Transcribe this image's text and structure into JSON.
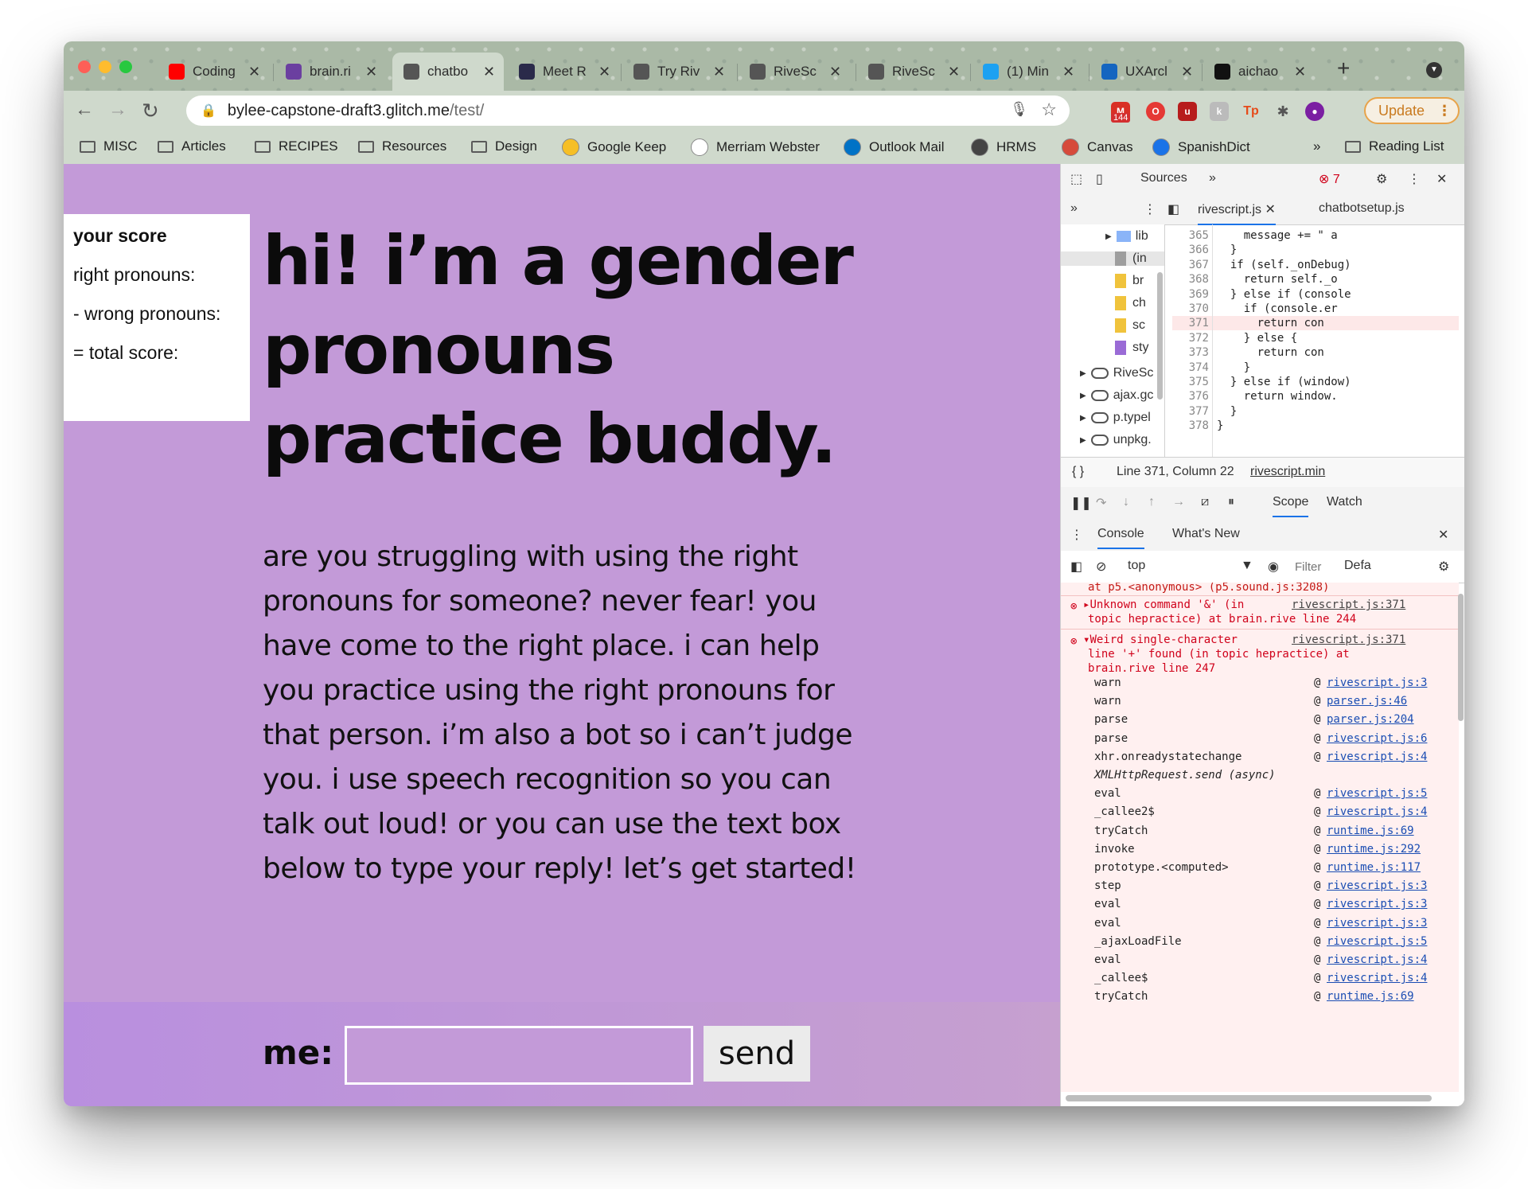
{
  "tabs": [
    {
      "title": "Coding",
      "icon": "youtube-icon",
      "color": "#ff0000",
      "active": false
    },
    {
      "title": "brain.ri",
      "icon": "brain-favicon",
      "color": "#6b3fa0",
      "active": false
    },
    {
      "title": "chatbo",
      "icon": "globe-icon",
      "color": "#555555",
      "active": true
    },
    {
      "title": "Meet R",
      "icon": "robot-icon",
      "color": "#2a2a4a",
      "active": false
    },
    {
      "title": "Try Riv",
      "icon": "rivescript-icon",
      "color": "#555555",
      "active": false
    },
    {
      "title": "RiveSc",
      "icon": "rivescript-icon",
      "color": "#555555",
      "active": false
    },
    {
      "title": "RiveSc",
      "icon": "rivescript-icon",
      "color": "#555555",
      "active": false
    },
    {
      "title": "(1) Min",
      "icon": "twitter-icon",
      "color": "#1da1f2",
      "active": false
    },
    {
      "title": "UXArcl",
      "icon": "ux-icon",
      "color": "#1565c0",
      "active": false
    },
    {
      "title": "aichao",
      "icon": "github-icon",
      "color": "#111111",
      "active": false
    }
  ],
  "toolbar": {
    "url_host": "bylee-capstone-draft3.glitch.me",
    "url_path": "/test/",
    "gmail_count": "144",
    "update_label": "Update",
    "update_menu": "⋮"
  },
  "bookmarks": [
    {
      "label": "MISC",
      "type": "folder"
    },
    {
      "label": "Articles",
      "type": "folder"
    },
    {
      "label": "RECIPES",
      "type": "folder"
    },
    {
      "label": "Resources",
      "type": "folder"
    },
    {
      "label": "Design",
      "type": "folder"
    },
    {
      "label": "Google Keep",
      "type": "site",
      "color": "#f6bf26"
    },
    {
      "label": "Merriam Webster",
      "type": "site",
      "color": "#ffffff"
    },
    {
      "label": "Outlook Mail",
      "type": "site",
      "color": "#0072c6"
    },
    {
      "label": "HRMS",
      "type": "site",
      "color": "#444444"
    },
    {
      "label": "Canvas",
      "type": "site",
      "color": "#d64a3b"
    },
    {
      "label": "SpanishDict",
      "type": "site",
      "color": "#1a73e8"
    }
  ],
  "bookmarks_more": "»",
  "reading_list": "Reading List",
  "page": {
    "score": {
      "heading": "your score",
      "right": "right pronouns:",
      "wrong": "- wrong pronouns:",
      "total": "= total score:"
    },
    "headline": "hi! i’m a gender pronouns practice buddy.",
    "intro": "are you struggling with using the right pronouns for someone? never fear! you have come to the right place. i can help you practice using the right pronouns for that person. i’m also a bot so i can’t judge you. i use speech recognition so you can talk out loud! or you can use the text box below to type your reply! let’s get started!",
    "me_label": "me:",
    "input_value": "",
    "send_label": "send"
  },
  "devtools": {
    "panel": "Sources",
    "more": "»",
    "error_count": "7",
    "open_files": [
      "rivescript.js",
      "chatbotsetup.js"
    ],
    "tree": [
      {
        "label": "lib",
        "kind": "folder"
      },
      {
        "label": "(in",
        "kind": "file"
      },
      {
        "label": "br",
        "kind": "file"
      },
      {
        "label": "ch",
        "kind": "file"
      },
      {
        "label": "sc",
        "kind": "file"
      },
      {
        "label": "sty",
        "kind": "file"
      },
      {
        "label": "RiveSc",
        "kind": "cloud"
      },
      {
        "label": "ajax.gc",
        "kind": "cloud"
      },
      {
        "label": "p.typel",
        "kind": "cloud"
      },
      {
        "label": "unpkg.",
        "kind": "cloud"
      }
    ],
    "code_lines": [
      {
        "n": "365",
        "text": "    message += \" a"
      },
      {
        "n": "366",
        "text": "  }"
      },
      {
        "n": "367",
        "text": "  if (self._onDebug)"
      },
      {
        "n": "368",
        "text": "    return self._o"
      },
      {
        "n": "369",
        "text": "  } else if (console"
      },
      {
        "n": "370",
        "text": "    if (console.er"
      },
      {
        "n": "371",
        "text": "      return con"
      },
      {
        "n": "372",
        "text": "    } else {"
      },
      {
        "n": "373",
        "text": "      return con"
      },
      {
        "n": "374",
        "text": "    }"
      },
      {
        "n": "375",
        "text": "  } else if (window)"
      },
      {
        "n": "376",
        "text": "    return window."
      },
      {
        "n": "377",
        "text": "  }"
      },
      {
        "n": "378",
        "text": "}"
      }
    ],
    "status": "Line 371, Column 22",
    "status_link": "rivescript.min",
    "scope_tab": "Scope",
    "watch_tab": "Watch",
    "console_tab": "Console",
    "whats_new_tab": "What's New",
    "context": "top",
    "filter_placeholder": "Filter",
    "levels": "Defa",
    "console_first": "at p5.<anonymous> (p5.sound.js:3208)",
    "error1": {
      "line1": "Unknown command '&' (in",
      "line2": "topic hepractice) at brain.rive line 244",
      "link": "rivescript.js:371"
    },
    "error2": {
      "line1": "Weird single-character",
      "line2": "line '+' found (in topic hepractice) at",
      "line3": "brain.rive line 247",
      "link": "rivescript.js:371"
    },
    "stack": [
      {
        "fn": "warn",
        "loc": "rivescript.js:3"
      },
      {
        "fn": "warn",
        "loc": "parser.js:46"
      },
      {
        "fn": "parse",
        "loc": "parser.js:204"
      },
      {
        "fn": "parse",
        "loc": "rivescript.js:6"
      },
      {
        "fn": "xhr.onreadystatechange",
        "loc": "rivescript.js:4"
      },
      {
        "fn": "XMLHttpRequest.send (async)",
        "loc": ""
      },
      {
        "fn": "eval",
        "loc": "rivescript.js:5"
      },
      {
        "fn": "_callee2$",
        "loc": "rivescript.js:4"
      },
      {
        "fn": "tryCatch",
        "loc": "runtime.js:69"
      },
      {
        "fn": "invoke",
        "loc": "runtime.js:292"
      },
      {
        "fn": "prototype.<computed>",
        "loc": "runtime.js:117"
      },
      {
        "fn": "step",
        "loc": "rivescript.js:3"
      },
      {
        "fn": "eval",
        "loc": "rivescript.js:3"
      },
      {
        "fn": "eval",
        "loc": "rivescript.js:3"
      },
      {
        "fn": "_ajaxLoadFile",
        "loc": "rivescript.js:5"
      },
      {
        "fn": "eval",
        "loc": "rivescript.js:4"
      },
      {
        "fn": "_callee$",
        "loc": "rivescript.js:4"
      },
      {
        "fn": "tryCatch",
        "loc": "runtime.js:69"
      }
    ]
  },
  "colors": {
    "page_bg": "#c39ad8",
    "accent_update": "#e8a34a",
    "error_red": "#d0021b"
  }
}
